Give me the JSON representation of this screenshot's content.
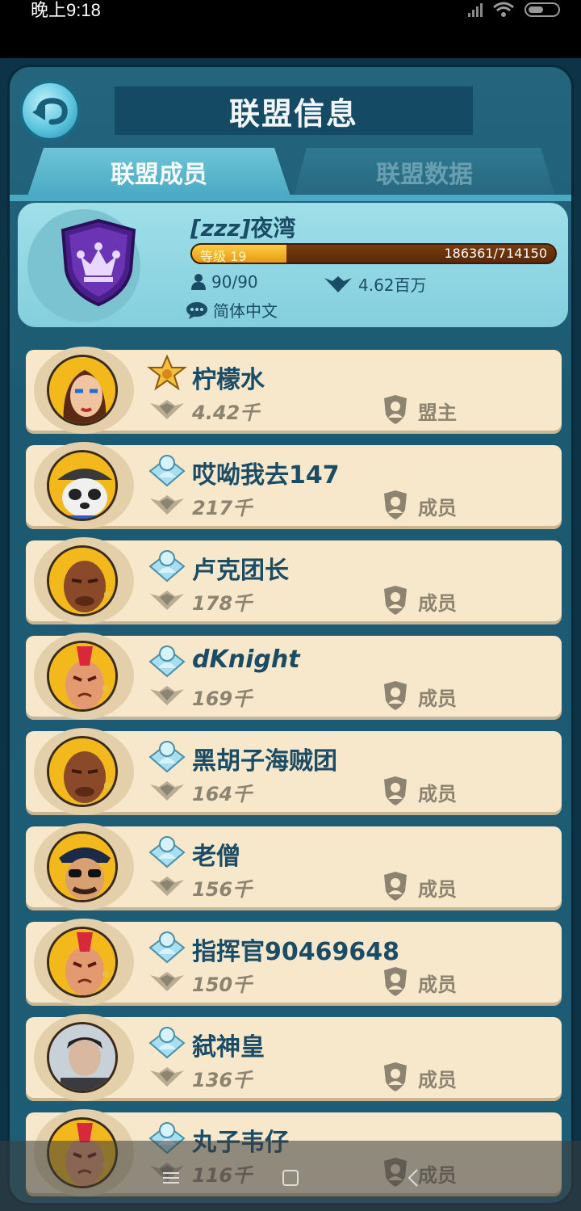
{
  "status_bar": {
    "time": "晚上9:18"
  },
  "header": {
    "title": "联盟信息"
  },
  "tabs": [
    {
      "label": "联盟成员",
      "active": true
    },
    {
      "label": "联盟数据",
      "active": false
    }
  ],
  "alliance": {
    "tag": "[zzz]",
    "name": "夜湾",
    "level_label": "等级 19",
    "xp_text": "186361/714150",
    "xp_progress": 0.261,
    "members": "90/90",
    "power": "4.62百万",
    "language": "简体中文"
  },
  "members": [
    {
      "name": "柠檬水",
      "power": "4.42千",
      "role": "盟主",
      "rank": "leader",
      "avatar": "woman-blue-eyeshadow"
    },
    {
      "name": "哎呦我去147",
      "power": "217千",
      "role": "成员",
      "rank": "member",
      "avatar": "panda-cap"
    },
    {
      "name": "卢克团长",
      "power": "178千",
      "role": "成员",
      "rank": "member",
      "avatar": "bald-brute"
    },
    {
      "name": "dKnight",
      "power": "169千",
      "role": "成员",
      "rank": "member",
      "avatar": "red-mohawk"
    },
    {
      "name": "黑胡子海贼团",
      "power": "164千",
      "role": "成员",
      "rank": "member",
      "avatar": "bald-brute"
    },
    {
      "name": "老僧",
      "power": "156千",
      "role": "成员",
      "rank": "member",
      "avatar": "sunglasses-cop"
    },
    {
      "name": "指挥官90469648",
      "power": "150千",
      "role": "成员",
      "rank": "member",
      "avatar": "red-mohawk"
    },
    {
      "name": "弑神皇",
      "power": "136千",
      "role": "成员",
      "rank": "member",
      "avatar": "photo-boy"
    },
    {
      "name": "丸子韦仔",
      "power": "116千",
      "role": "成员",
      "rank": "member",
      "avatar": "red-mohawk"
    }
  ],
  "colors": {
    "panel": "#1d5d75",
    "card": "#f7e8cc",
    "accent": "#4aaac3",
    "name_text": "#1b4c66"
  }
}
